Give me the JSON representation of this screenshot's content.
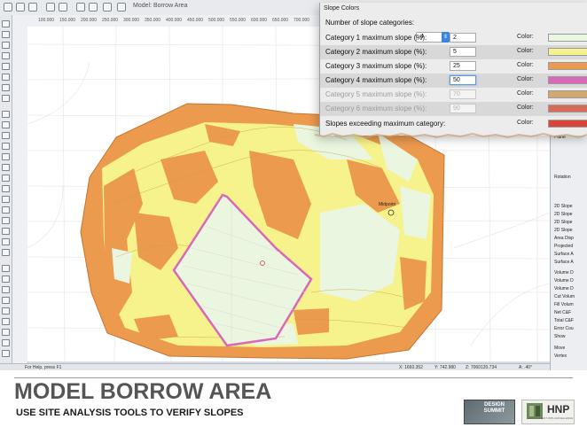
{
  "app": {
    "title": "Model: Borrow Area",
    "top_ruler_labels": [
      "100.000",
      "150.000",
      "200.000",
      "250.000",
      "300.000",
      "350.000",
      "400.000",
      "450.000",
      "500.000",
      "550.000",
      "600.000",
      "650.000",
      "700.000"
    ],
    "status": {
      "help": "For Help, press F1",
      "x": "X: 1660.352",
      "y": "Y: 742.980",
      "z": "Z: 7060120.734",
      "angle": "A: .40°"
    },
    "map_label": "Midpoint",
    "right_panel_items": [
      "Plane",
      "Rotation",
      "2D Slope",
      "2D Slope",
      "2D Slope",
      "2D Slope",
      "Area Disp",
      "Projected",
      "Surface A",
      "Surface A",
      "Volume D",
      "Volume D",
      "Volume D",
      "Cut Volum",
      "Fill Volum",
      "Net C&F",
      "Total C&F",
      "Error Cou",
      "Show",
      "Move",
      "Vertex"
    ]
  },
  "dialog": {
    "title": "Slope Colors",
    "num_categories_label": "Number of slope categories:",
    "num_categories_value": "4",
    "color_label": "Color:",
    "categories": [
      {
        "label": "Category 1 maximum slope (%):",
        "value": "2",
        "color": "#eaf6e0",
        "enabled": true
      },
      {
        "label": "Category 2 maximum slope (%):",
        "value": "5",
        "color": "#f6f28c",
        "enabled": true
      },
      {
        "label": "Category 3 maximum slope (%):",
        "value": "25",
        "color": "#ec9a4e",
        "enabled": true
      },
      {
        "label": "Category 4 maximum slope (%):",
        "value": "50",
        "color": "#d968b8",
        "enabled": true
      },
      {
        "label": "Category 5 maximum slope (%):",
        "value": "70",
        "color": "#d1a86e",
        "enabled": false
      },
      {
        "label": "Category 6 maximum slope (%):",
        "value": "90",
        "color": "#d96a58",
        "enabled": false
      }
    ],
    "exceeding_label": "Slopes exceeding maximum category:",
    "exceeding_color": "#d9453a"
  },
  "footer": {
    "title": "MODEL BORROW AREA",
    "subtitle": "USE SITE ANALYSIS TOOLS TO VERIFY SLOPES",
    "summit_logo_text": "DESIGN SUMMIT",
    "hnp_logo_text": "HNP",
    "hnp_tagline": "ENVIRONMENT WITH EXCELLENCE"
  },
  "colors": {
    "flat": "#eaf6e0",
    "gentle": "#f6f28c",
    "moderate": "#ec9a4e",
    "steep": "#d968b8",
    "accent": "#3d85de"
  }
}
